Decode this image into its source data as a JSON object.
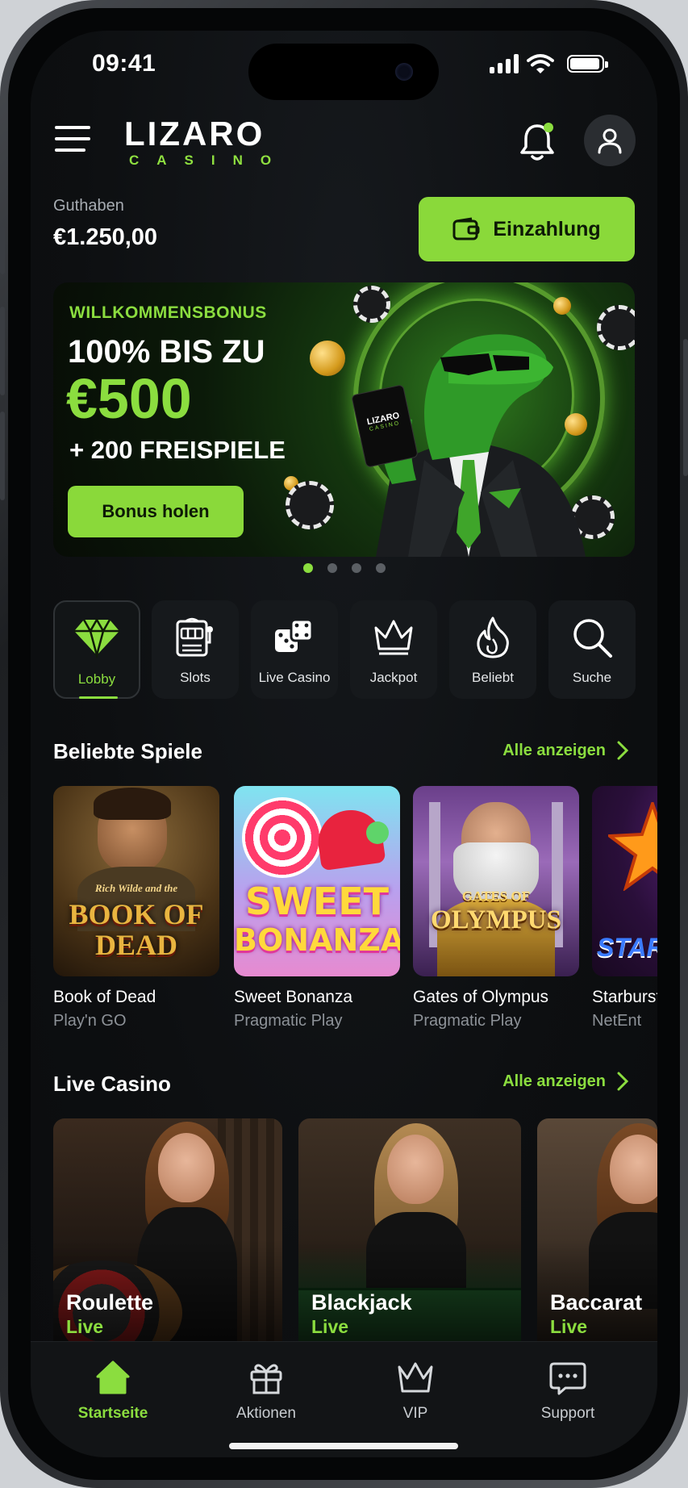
{
  "status_bar": {
    "time": "09:41",
    "battery_level": 0.95
  },
  "header": {
    "logo_main": "LIZARO",
    "logo_sub": "CASINO",
    "menu_icon": "hamburger-icon",
    "notification_icon": "bell-icon",
    "profile_icon": "user-icon"
  },
  "balance": {
    "label": "Guthaben",
    "value": "€1.250,00"
  },
  "deposit": {
    "label": "Einzahlung",
    "icon": "wallet-icon"
  },
  "banner": {
    "tag": "WILLKOMMENSBONUS",
    "line1": "100% BIS ZU",
    "amount": "€500",
    "spins": "+ 200 FREISPIELE",
    "cta": "Bonus holen",
    "card_text_1": "LIZARO",
    "card_text_2": "CASINO"
  },
  "carousel": {
    "total": 4,
    "active_index": 0
  },
  "categories": [
    {
      "label": "Lobby",
      "icon": "diamond-icon",
      "active": true
    },
    {
      "label": "Slots",
      "icon": "slot-machine-icon",
      "active": false
    },
    {
      "label": "Live Casino",
      "icon": "dice-icon",
      "active": false
    },
    {
      "label": "Jackpot",
      "icon": "crown-icon",
      "active": false
    },
    {
      "label": "Beliebt",
      "icon": "flame-icon",
      "active": false
    },
    {
      "label": "Suche",
      "icon": "search-icon",
      "active": false
    }
  ],
  "popular": {
    "title": "Beliebte Spiele",
    "see_all": "Alle anzeigen",
    "games": [
      {
        "name": "Book of Dead",
        "provider": "Play'n GO",
        "thumb_top": "Rich Wilde and the",
        "thumb_main": "BOOK OF DEAD"
      },
      {
        "name": "Sweet Bonanza",
        "provider": "Pragmatic Play",
        "thumb_top": "SWEET",
        "thumb_main": "BONANZA"
      },
      {
        "name": "Gates of Olympus",
        "provider": "Pragmatic Play",
        "thumb_top": "GATES OF",
        "thumb_main": "OLYMPUS"
      },
      {
        "name": "Starburst",
        "provider": "NetEnt",
        "thumb_main": "STAR"
      }
    ]
  },
  "live_casino": {
    "title": "Live Casino",
    "see_all": "Alle anzeigen",
    "tables": [
      {
        "name": "Roulette",
        "status": "Live"
      },
      {
        "name": "Blackjack",
        "status": "Live"
      },
      {
        "name": "Baccarat",
        "status": "Live"
      }
    ]
  },
  "bottom_nav": [
    {
      "label": "Startseite",
      "icon": "home-icon",
      "active": true
    },
    {
      "label": "Aktionen",
      "icon": "gift-icon",
      "active": false
    },
    {
      "label": "VIP",
      "icon": "crown-icon",
      "active": false
    },
    {
      "label": "Support",
      "icon": "chat-icon",
      "active": false
    }
  ],
  "colors": {
    "accent": "#8bdd3f",
    "background": "#0d0f11",
    "card": "#16191c"
  }
}
